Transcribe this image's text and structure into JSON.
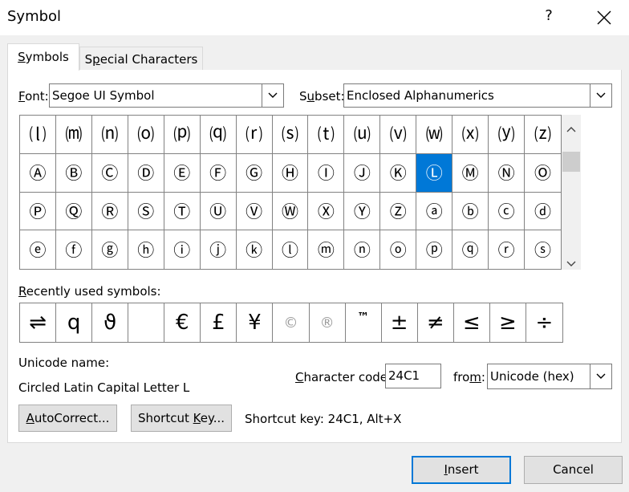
{
  "window": {
    "title": "Symbol",
    "help": "?"
  },
  "tabs": {
    "symbols": {
      "hot": "S",
      "rest": "ymbols"
    },
    "special": {
      "pre": "S",
      "hot": "p",
      "rest": "ecial Characters"
    }
  },
  "font": {
    "hot": "F",
    "rest": "ont:",
    "value": "Segoe UI Symbol"
  },
  "subset": {
    "pre": "S",
    "hot": "u",
    "rest": "bset:",
    "value": "Enclosed Alphanumerics"
  },
  "symbols": [
    "⒧",
    "⒨",
    "⒩",
    "⒪",
    "⒫",
    "⒬",
    "⒭",
    "⒮",
    "⒯",
    "⒰",
    "⒱",
    "⒲",
    "⒳",
    "⒴",
    "⒵",
    "Ⓐ",
    "Ⓑ",
    "Ⓒ",
    "Ⓓ",
    "Ⓔ",
    "Ⓕ",
    "Ⓖ",
    "Ⓗ",
    "Ⓘ",
    "Ⓙ",
    "Ⓚ",
    "Ⓛ",
    "Ⓜ",
    "Ⓝ",
    "Ⓞ",
    "Ⓟ",
    "Ⓠ",
    "Ⓡ",
    "Ⓢ",
    "Ⓣ",
    "Ⓤ",
    "Ⓥ",
    "Ⓦ",
    "Ⓧ",
    "Ⓨ",
    "Ⓩ",
    "ⓐ",
    "ⓑ",
    "ⓒ",
    "ⓓ",
    "ⓔ",
    "ⓕ",
    "ⓖ",
    "ⓗ",
    "ⓘ",
    "ⓙ",
    "ⓚ",
    "ⓛ",
    "ⓜ",
    "ⓝ",
    "ⓞ",
    "ⓟ",
    "ⓠ",
    "ⓡ",
    "ⓢ"
  ],
  "selected_index": 26,
  "recent": {
    "label_hot": "R",
    "label_rest": "ecently used symbols:",
    "items": [
      "⇌",
      "q",
      "ϑ",
      " ",
      "€",
      "£",
      "¥",
      "©",
      "®",
      "™",
      "±",
      "≠",
      "≤",
      "≥",
      "÷"
    ]
  },
  "unicode_name": {
    "label": "Unicode name:",
    "value": "Circled Latin Capital Letter L"
  },
  "char_code": {
    "hot": "C",
    "rest": "haracter code:",
    "value": "24C1"
  },
  "from": {
    "pre": "fro",
    "hot": "m",
    "rest": ":",
    "value": "Unicode (hex)"
  },
  "buttons": {
    "autocorrect": {
      "hot": "A",
      "rest": "utoCorrect..."
    },
    "shortcut": {
      "pre": "Shortcut ",
      "hot": "K",
      "rest": "ey..."
    },
    "insert": {
      "hot": "I",
      "rest": "nsert"
    },
    "cancel": "Cancel"
  },
  "shortcut_text": "Shortcut key: 24C1, Alt+X",
  "colors": {
    "selection": "#0078d7",
    "default_border": "#0078d7"
  },
  "icons": {
    "close": "close-icon",
    "dropdown": "chevron-down-icon",
    "scroll_up": "chevron-up-icon",
    "scroll_down": "chevron-down-icon"
  }
}
